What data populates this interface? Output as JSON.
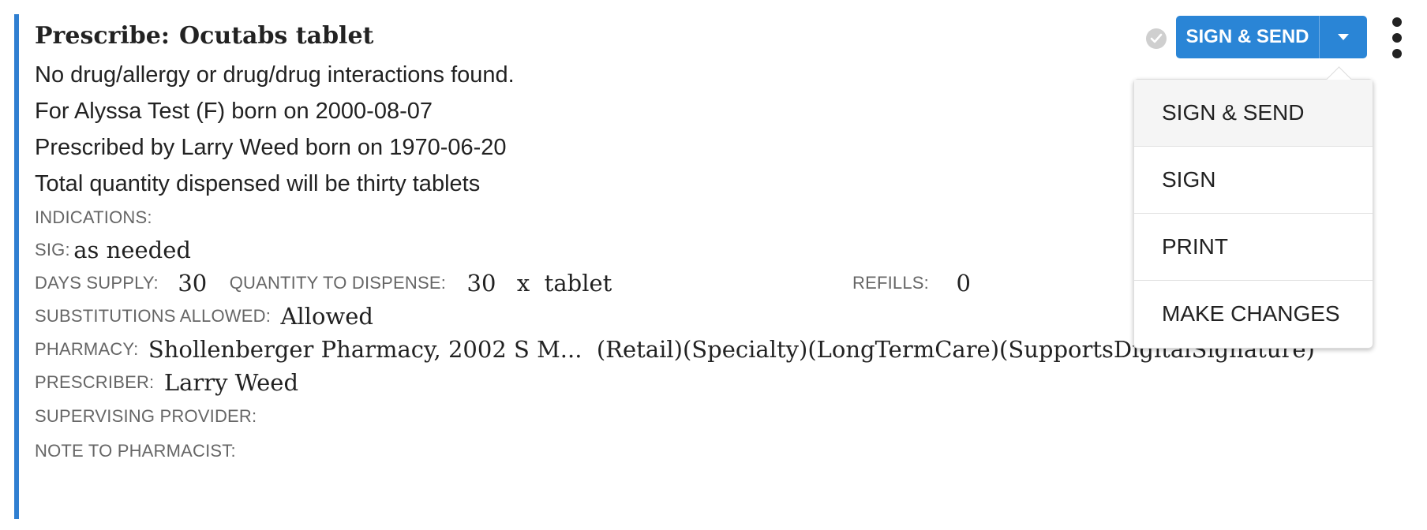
{
  "header": {
    "title_prefix": "Prescribe:",
    "title_drug": "Ocutabs tablet"
  },
  "summary": [
    "No drug/allergy or drug/drug interactions found.",
    "For Alyssa Test (F) born on 2000-08-07",
    "Prescribed by Larry Weed born on 1970-06-20",
    "Total quantity dispensed will be thirty tablets"
  ],
  "fields": {
    "indications_label": "INDICATIONS:",
    "indications_value": "",
    "sig_label": "SIG:",
    "sig_value": "as needed",
    "days_supply_label": "DAYS SUPPLY:",
    "days_supply_value": "30",
    "quantity_label": "QUANTITY TO DISPENSE:",
    "quantity_value": "30",
    "quantity_unit": "x  tablet",
    "refills_label": "REFILLS:",
    "refills_value": "0",
    "substitutions_label": "SUBSTITUTIONS ALLOWED:",
    "substitutions_value": "Allowed",
    "pharmacy_label": "PHARMACY:",
    "pharmacy_value": "Shollenberger Pharmacy, 2002 S M...  (Retail)(Specialty)(LongTermCare)(SupportsDigitalSignature)",
    "prescriber_label": "PRESCRIBER:",
    "prescriber_value": "Larry Weed",
    "supervising_label": "SUPERVISING PROVIDER:",
    "supervising_value": "",
    "note_label": "NOTE TO PHARMACIST:",
    "note_value": ""
  },
  "actions": {
    "primary_label": "SIGN & SEND",
    "status_icon": "check-circle-icon",
    "caret_icon": "caret-down-icon",
    "more_icon": "kebab-icon"
  },
  "dropdown": {
    "items": [
      "SIGN & SEND",
      "SIGN",
      "PRINT",
      "MAKE CHANGES"
    ]
  },
  "colors": {
    "accent": "#2f7fd1",
    "primary_button": "#2a85d6",
    "label_gray": "#666666"
  }
}
